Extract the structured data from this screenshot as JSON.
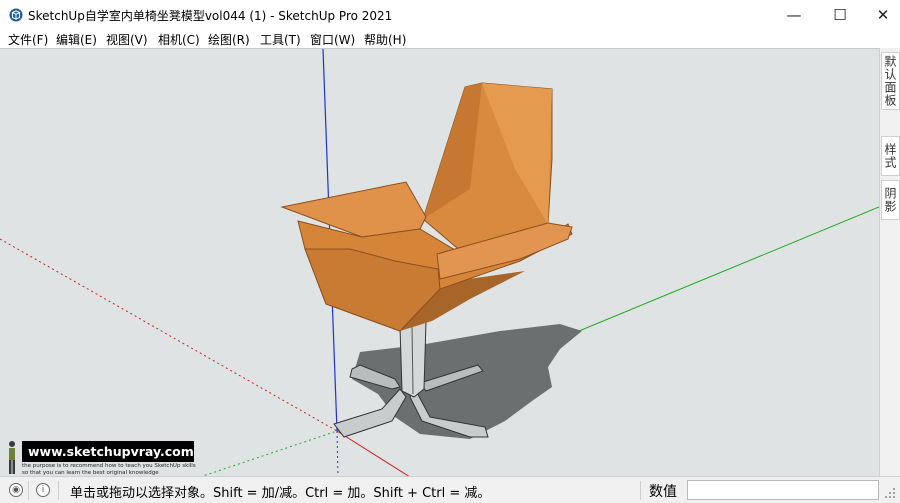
{
  "window": {
    "title": "SketchUp自学室内单椅坐凳模型vol044 (1) - SketchUp Pro 2021",
    "minimize_glyph": "—",
    "maximize_glyph": "☐",
    "close_glyph": "✕"
  },
  "menu": {
    "items": [
      "文件(F)",
      "编辑(E)",
      "视图(V)",
      "相机(C)",
      "绘图(R)",
      "工具(T)",
      "窗口(W)",
      "帮助(H)"
    ]
  },
  "tray": {
    "tabs": [
      "默认面板",
      "样式",
      "阴影"
    ]
  },
  "watermark": {
    "site": "www.sketchupvray.com",
    "tagline": "the purpose is to recommend how to teach you SketchUp skills so that you can learn the best original knowledge"
  },
  "status": {
    "message": "单击或拖动以选择对象。Shift = 加/减。Ctrl = 加。Shift + Ctrl = 减。",
    "measurements_label": "数值",
    "measurements_value": ""
  },
  "colors": {
    "viewport_bg": "#dfe3e4",
    "axis_red": "#cc2222",
    "axis_green": "#22aa22",
    "axis_blue": "#2233cc",
    "chair_orange": "#d98a3e",
    "shadow": "#6c6f70"
  },
  "icons": {
    "app": "sketchup-logo-icon",
    "status_left_1": "geo-location-icon",
    "status_left_2": "info-icon",
    "resize": "resize-grip-icon"
  }
}
